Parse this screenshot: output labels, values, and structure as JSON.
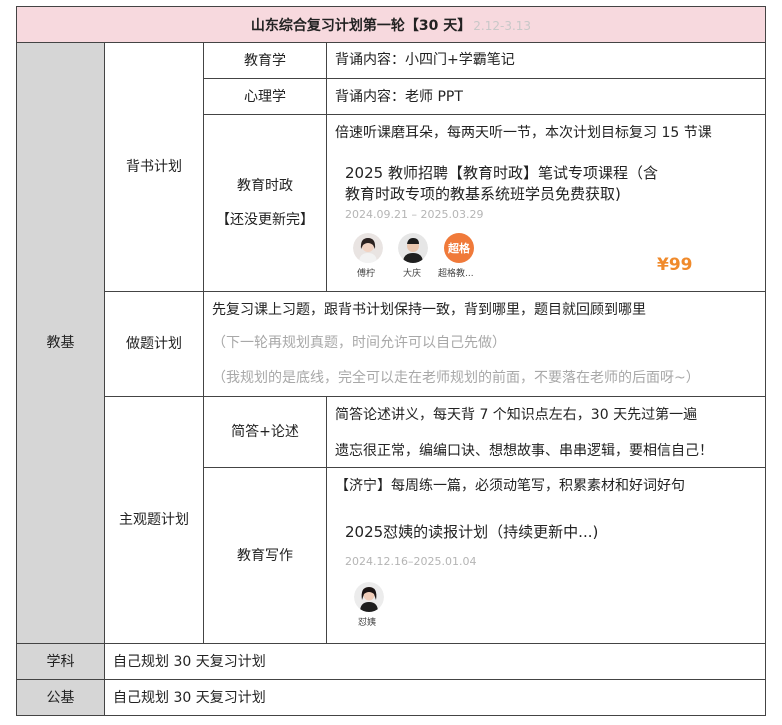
{
  "title": {
    "main": "山东综合复习计划第一轮【30 天】",
    "dates": "2.12-3.13"
  },
  "jiaoji": {
    "label": "教基",
    "beishu": {
      "label": "背书计划",
      "jiaoyuxue": {
        "label": "教育学",
        "content": "背诵内容：小四门+学霸笔记"
      },
      "xinlixue": {
        "label": "心理学",
        "content": "背诵内容：老师 PPT"
      },
      "shizheng": {
        "label_line1": "教育时政",
        "label_line2": "【还没更新完】",
        "content": "倍速听课磨耳朵，每两天听一节，本次计划目标复习 15 节课",
        "course": {
          "title_line1": "2025 教师招聘【教育时政】笔试专项课程（含",
          "title_line2": "教育时政专项的教基系统班学员免费获取)",
          "date": "2024.09.21 – 2025.03.29",
          "teachers": [
            {
              "name": "傅柠",
              "icon": "teacher-avatar-female"
            },
            {
              "name": "大庆",
              "icon": "teacher-avatar-male"
            },
            {
              "name": "超格教...",
              "icon": "chaoge-logo",
              "logo_text": "超格"
            }
          ],
          "price": "¥99"
        }
      }
    },
    "zuoti": {
      "label": "做题计划",
      "line1": "先复习课上习题，跟背书计划保持一致，背到哪里，题目就回顾到哪里",
      "line2": "（下一轮再规划真题，时间允许可以自己先做）",
      "line3": "（我规划的是底线，完全可以走在老师规划的前面，不要落在老师的后面呀~）"
    },
    "zhuguan": {
      "label": "主观题计划",
      "jianda": {
        "label": "简答+论述",
        "line1": "简答论述讲义，每天背 7 个知识点左右，30 天先过第一遍",
        "line2": "遗忘很正常，编编口诀、想想故事、串串逻辑，要相信自己！"
      },
      "xiezuo": {
        "label": "教育写作",
        "content": "【济宁】每周练一篇，必须动笔写，积累素材和好词好句",
        "course": {
          "title": "2025怼姨的读报计划（持续更新中...)",
          "date": "2024.12.16–2025.01.04",
          "teacher": {
            "name": "怼姨",
            "icon": "teacher-avatar-female"
          }
        }
      }
    }
  },
  "xueke": {
    "label": "学科",
    "content": "自己规划 30 天复习计划"
  },
  "gongji": {
    "label": "公基",
    "content": "自己规划 30 天复习计划"
  }
}
